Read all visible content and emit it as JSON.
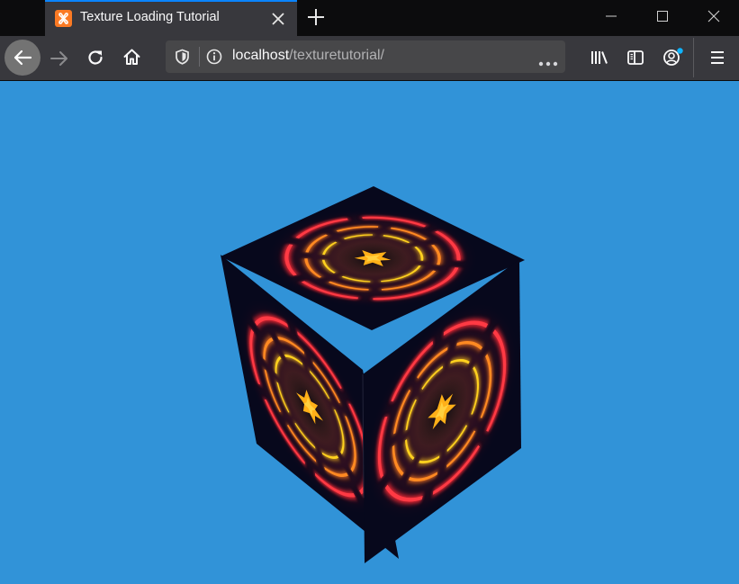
{
  "tab": {
    "title": "Texture Loading Tutorial",
    "favicon": "xampp-icon",
    "favicon_color": "#fb7a24"
  },
  "address_bar": {
    "host": "localhost",
    "path": "/texturetutorial/"
  },
  "icons": {
    "back": "back-arrow-icon",
    "forward": "forward-arrow-icon",
    "reload": "reload-icon",
    "home": "home-icon",
    "tracking": "shield-icon",
    "site_info": "info-icon",
    "page_actions": "more-horizontal-icon",
    "library": "library-icon",
    "sidebar": "sidebar-icon",
    "account": "account-icon",
    "menu": "hamburger-menu-icon",
    "new_tab": "plus-icon",
    "close_tab": "close-icon",
    "minimize": "minimize-icon",
    "maximize": "maximize-icon",
    "close_window": "close-window-icon"
  },
  "colors": {
    "accent": "#0a84ff",
    "canvas_background": "#3193d8",
    "cube_face": "#07081c",
    "ring_outer": "#f0323c",
    "ring_middle": "#f7a014",
    "ring_inner": "#ffd21e"
  },
  "scene": {
    "object": "textured-cube"
  }
}
